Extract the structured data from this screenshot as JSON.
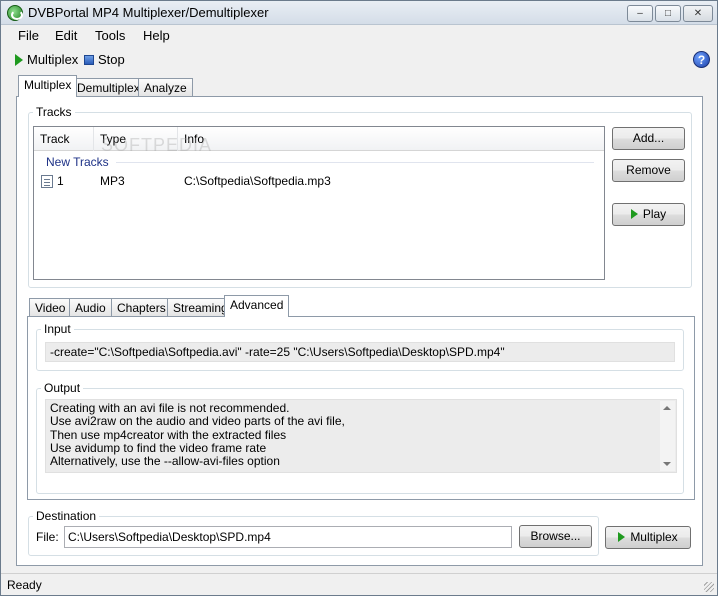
{
  "window": {
    "title": "DVBPortal MP4 Multiplexer/Demultiplexer",
    "controls": {
      "minimize": "–",
      "maximize": "□",
      "close": "✕"
    }
  },
  "menu": {
    "items": [
      "File",
      "Edit",
      "Tools",
      "Help"
    ]
  },
  "toolbar": {
    "multiplex_label": "Multiplex",
    "stop_label": "Stop",
    "help_label": "?"
  },
  "main_tabs": {
    "items": [
      "Multiplex",
      "Demultiplex",
      "Analyze"
    ],
    "active": "Multiplex"
  },
  "tracks": {
    "group_label": "Tracks",
    "columns": [
      "Track",
      "Type",
      "Info"
    ],
    "watermark": "SOFTPEDIA",
    "group_header": "New Tracks",
    "rows": [
      {
        "track": "1",
        "type": "MP3",
        "info": "C:\\Softpedia\\Softpedia.mp3"
      }
    ],
    "buttons": {
      "add": "Add...",
      "remove": "Remove",
      "play": "Play"
    }
  },
  "sub_tabs": {
    "items": [
      "Video",
      "Audio",
      "Chapters",
      "Streaming",
      "Advanced"
    ],
    "active": "Advanced"
  },
  "advanced": {
    "input_label": "Input",
    "input_value": "-create=\"C:\\Softpedia\\Softpedia.avi\" -rate=25 \"C:\\Users\\Softpedia\\Desktop\\SPD.mp4\"",
    "output_label": "Output",
    "output_lines": [
      "Creating with an avi file is not recommended.",
      "Use avi2raw on the audio and video parts of the avi file,",
      "Then use mp4creator with the extracted files",
      "Use avidump to find the video frame rate",
      "Alternatively, use the --allow-avi-files option"
    ]
  },
  "destination": {
    "group_label": "Destination",
    "file_label": "File:",
    "file_value": "C:\\Users\\Softpedia\\Desktop\\SPD.mp4",
    "browse_label": "Browse...",
    "multiplex_label": "Multiplex"
  },
  "status": {
    "text": "Ready"
  }
}
